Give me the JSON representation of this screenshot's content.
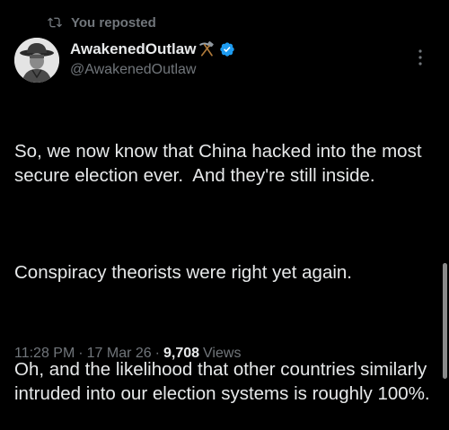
{
  "repost": {
    "label": "You reposted",
    "icon": "repost-icon"
  },
  "author": {
    "display_name": "AwakenedOutlaw",
    "name_emoji": "hammer-and-pick",
    "verified": true,
    "verified_color": "#1d9bf0",
    "handle": "@AwakenedOutlaw"
  },
  "tweet": {
    "paragraphs": [
      "So, we now know that China hacked into the most secure election ever.  And they're still inside.",
      "Conspiracy theorists were right yet again.",
      "Oh, and the likelihood that other countries similarly intruded into our election systems is roughly 100%."
    ]
  },
  "meta": {
    "time": "11:28 PM",
    "sep1": "·",
    "date": "17 Mar 26",
    "sep2": "·",
    "views_count": "9,708",
    "views_label": "Views"
  },
  "colors": {
    "background": "#000000",
    "text": "#e7e9ea",
    "muted": "#71767b",
    "accent": "#1d9bf0"
  }
}
